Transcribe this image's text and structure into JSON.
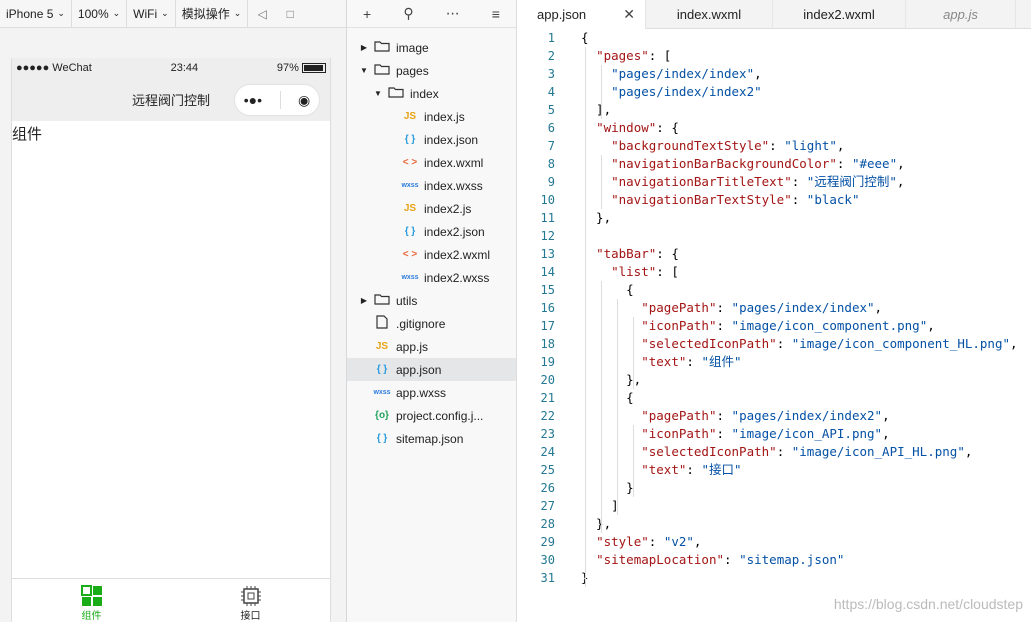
{
  "simulator": {
    "toolbar": [
      {
        "label": "iPhone 5",
        "name": "device-select"
      },
      {
        "label": "100%",
        "name": "zoom-select"
      },
      {
        "label": "WiFi",
        "name": "network-select"
      },
      {
        "label": "模拟操作",
        "name": "simulate-select"
      }
    ],
    "status": {
      "carrier": "●●●●● WeChat",
      "time": "23:44",
      "battery": "97%"
    },
    "nav_title": "远程阀门控制",
    "content_text": "组件",
    "tabs": [
      {
        "label": "组件",
        "color": "#1aad19"
      },
      {
        "label": "接口",
        "color": "#222222"
      }
    ]
  },
  "tree": {
    "items": [
      {
        "label": "image",
        "type": "folder",
        "depth": 0,
        "open": false
      },
      {
        "label": "pages",
        "type": "folder",
        "depth": 0,
        "open": true
      },
      {
        "label": "index",
        "type": "folder",
        "depth": 1,
        "open": true
      },
      {
        "label": "index.js",
        "type": "js",
        "depth": 2,
        "icon": "JS"
      },
      {
        "label": "index.json",
        "type": "json",
        "depth": 2,
        "icon": "{ }"
      },
      {
        "label": "index.wxml",
        "type": "wxml",
        "depth": 2,
        "icon": "< >"
      },
      {
        "label": "index.wxss",
        "type": "wxss",
        "depth": 2,
        "icon": "wxss"
      },
      {
        "label": "index2.js",
        "type": "js",
        "depth": 2,
        "icon": "JS"
      },
      {
        "label": "index2.json",
        "type": "json",
        "depth": 2,
        "icon": "{ }"
      },
      {
        "label": "index2.wxml",
        "type": "wxml",
        "depth": 2,
        "icon": "< >"
      },
      {
        "label": "index2.wxss",
        "type": "wxss",
        "depth": 2,
        "icon": "wxss"
      },
      {
        "label": "utils",
        "type": "folder",
        "depth": 0,
        "open": false
      },
      {
        "label": ".gitignore",
        "type": "file",
        "depth": 0
      },
      {
        "label": "app.js",
        "type": "js",
        "depth": 0,
        "icon": "JS"
      },
      {
        "label": "app.json",
        "type": "json",
        "depth": 0,
        "icon": "{ }",
        "selected": true
      },
      {
        "label": "app.wxss",
        "type": "wxss",
        "depth": 0,
        "icon": "wxss"
      },
      {
        "label": "project.config.j...",
        "type": "cfg",
        "depth": 0,
        "icon": "{o}"
      },
      {
        "label": "sitemap.json",
        "type": "json",
        "depth": 0,
        "icon": "{ }"
      }
    ]
  },
  "editor": {
    "tabs": [
      {
        "label": "app.json",
        "active": true
      },
      {
        "label": "index.wxml"
      },
      {
        "label": "index2.wxml"
      },
      {
        "label": "app.js",
        "dim": true
      }
    ],
    "lines": [
      "{",
      "  \"pages\": [",
      "    \"pages/index/index\",",
      "    \"pages/index/index2\"",
      "  ],",
      "  \"window\": {",
      "    \"backgroundTextStyle\": \"light\",",
      "    \"navigationBarBackgroundColor\": \"#eee\",",
      "    \"navigationBarTitleText\": \"远程阀门控制\",",
      "    \"navigationBarTextStyle\": \"black\"",
      "  },",
      "",
      "  \"tabBar\": {",
      "    \"list\": [",
      "      {",
      "        \"pagePath\": \"pages/index/index\",",
      "        \"iconPath\": \"image/icon_component.png\",",
      "        \"selectedIconPath\": \"image/icon_component_HL.png\",",
      "        \"text\": \"组件\"",
      "      },",
      "      {",
      "        \"pagePath\": \"pages/index/index2\",",
      "        \"iconPath\": \"image/icon_API.png\",",
      "        \"selectedIconPath\": \"image/icon_API_HL.png\",",
      "        \"text\": \"接口\"",
      "      }",
      "    ]",
      "  },",
      "  \"style\": \"v2\",",
      "  \"sitemapLocation\": \"sitemap.json\"",
      "}"
    ]
  },
  "watermark": "https://blog.csdn.net/cloudstep"
}
